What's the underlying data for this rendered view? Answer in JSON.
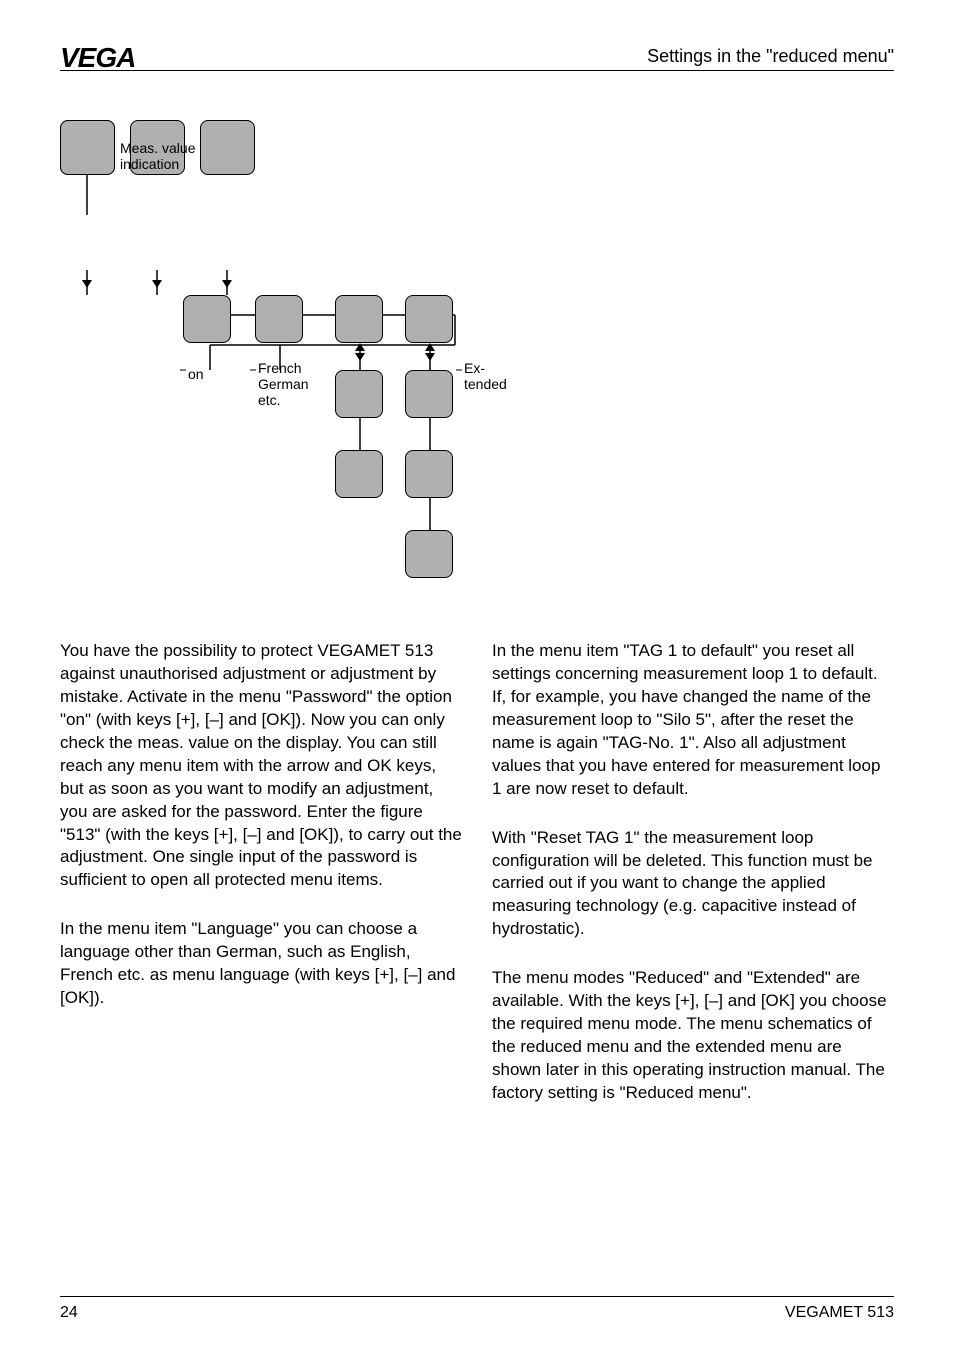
{
  "logo_text": "VEGA",
  "header_right": "Settings in the \"reduced menu\"",
  "diagram": {
    "meas_label": "Meas. value\nindication",
    "on_label": "on",
    "lang_label": "French\nGerman\netc.",
    "ext_label": "Ex-\ntended"
  },
  "left_col": {
    "p1": "You have the possibility to protect VEGAMET 513 against unauthorised adjustment or adjustment by mistake. Activate in the menu \"Password\" the option \"on\" (with keys [+], [–] and [OK]). Now you can only check the meas. value on the display. You can still reach any menu item with the arrow and OK keys, but as soon as you want to modify an adjustment, you are asked for the password. Enter the figure \"513\" (with the keys [+], [–] and [OK]), to carry out the adjustment. One single input of the password is sufficient to open all protected menu items.",
    "p2": "In the menu item \"Language\" you can choose a language other than German, such as English, French etc. as menu language (with keys [+], [–] and [OK])."
  },
  "right_col": {
    "p1": "In the menu item \"TAG 1 to default\" you reset all settings concerning measurement loop 1 to default. If, for example, you have changed the name of the measurement loop to \"Silo 5\", after the reset the name is again \"TAG-No. 1\". Also all adjustment values that you have entered for measurement loop 1 are now reset to default.",
    "p2": "With \"Reset TAG 1\" the measurement loop configuration will be deleted. This function must be carried out if you want to change the applied measuring technology (e.g. capacitive instead of hydrostatic).",
    "p3": "The menu modes \"Reduced\" and \"Extended\" are available. With the keys [+], [–] and [OK] you choose the required menu mode. The menu schematics of the reduced menu and the extended menu are shown later in this operating instruction manual. The factory setting is \"Reduced menu\"."
  },
  "page_number": "24",
  "product": "VEGAMET 513"
}
